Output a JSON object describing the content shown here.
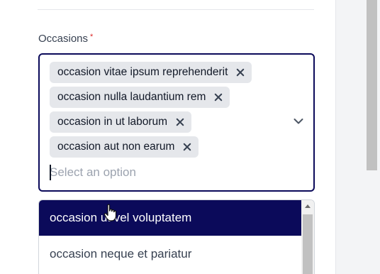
{
  "form": {
    "field_label": "Occasions",
    "required_mark": "*",
    "selected_chips": [
      {
        "label": "occasion vitae ipsum reprehenderit"
      },
      {
        "label": "occasion nulla laudantium rem"
      },
      {
        "label": "occasion in ut laborum"
      },
      {
        "label": "occasion aut non earum"
      }
    ],
    "search_placeholder": "Select an option"
  },
  "dropdown": {
    "options": [
      {
        "label": "occasion ut vel voluptatem",
        "highlighted": true
      },
      {
        "label": "occasion neque et pariatur",
        "highlighted": false
      }
    ]
  },
  "icons": {
    "chip_remove": "close-icon",
    "toggle": "chevron-down-icon",
    "scroll_up": "arrow-up-icon",
    "pointer": "hand-cursor-icon"
  },
  "colors": {
    "accent": "#0b0a5a",
    "chip_bg": "#e5e7eb",
    "required": "#dc2626"
  }
}
